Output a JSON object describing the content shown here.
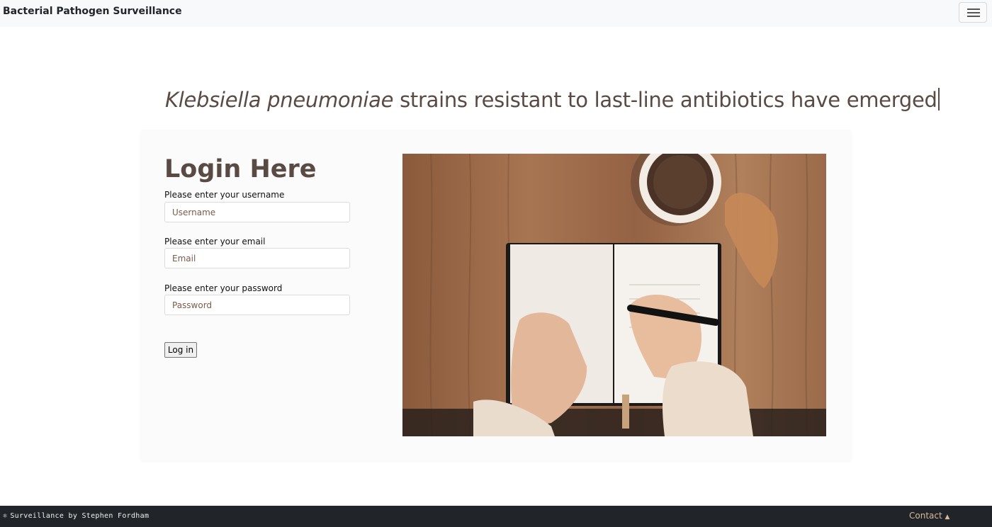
{
  "navbar": {
    "brand": "Bacterial Pathogen Surveillance",
    "menu_icon": "hamburger-menu-icon"
  },
  "headline": {
    "italic": "Klebsiella pneumoniae",
    "rest": " strains resistant to last-line antibiotics have emerged"
  },
  "login": {
    "title": "Login Here",
    "username_label": "Please enter your username",
    "username_placeholder": "Username",
    "username_value": "",
    "email_label": "Please enter your email",
    "email_placeholder": "Email",
    "email_value": "",
    "password_label": "Please enter your password",
    "password_placeholder": "Password",
    "password_value": "",
    "submit_label": "Log in"
  },
  "image": {
    "description_icon": "notebook-writing-photo"
  },
  "footer": {
    "credit": "Surveillance by Stephen Fordham",
    "credit_icon": "bacteria-icon",
    "contact_label": "Contact",
    "contact_icon": "caret-up-icon"
  },
  "colors": {
    "accent": "#5a4a44",
    "footer_bg": "#212529",
    "contact_link": "#d7b99a"
  }
}
